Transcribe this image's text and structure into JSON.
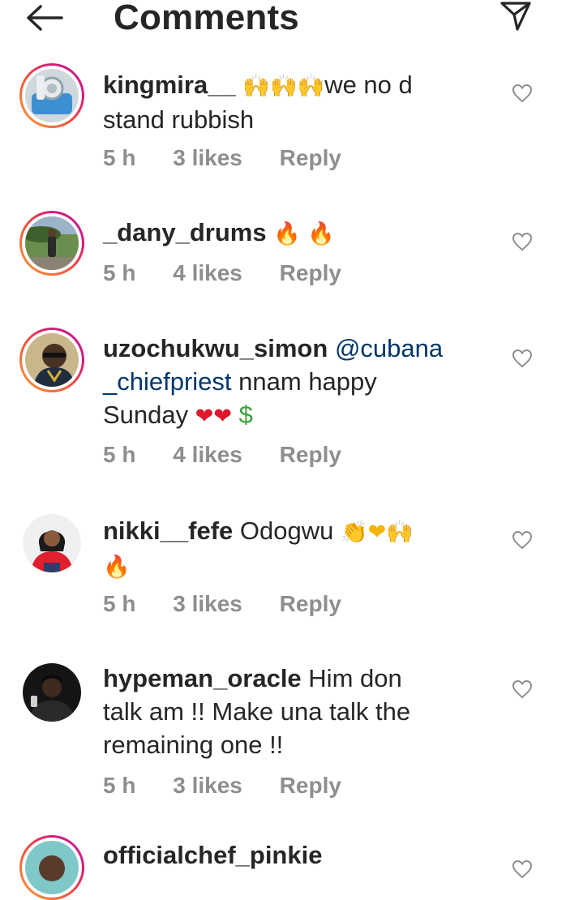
{
  "header": {
    "title": "Comments",
    "back_icon": "arrow-left-icon",
    "share_icon": "paper-plane-icon"
  },
  "colors": {
    "text": "#262626",
    "meta": "#8e8e8e",
    "mention": "#00376b",
    "story_ring_start": "#f9a13a",
    "story_ring_end": "#b32aa9"
  },
  "comments": [
    {
      "username": "kingmira__",
      "emoji_prefix": "🙌🙌🙌",
      "text_line1": "we no d",
      "text_line2": "stand rubbish",
      "time": "5 h",
      "likes": "3 likes",
      "reply": "Reply",
      "has_story_ring": true
    },
    {
      "username": "_dany_drums",
      "emoji_suffix": "🔥 🔥",
      "time": "5 h",
      "likes": "4 likes",
      "reply": "Reply",
      "has_story_ring": true
    },
    {
      "username": "uzochukwu_simon",
      "mention_line1": "@cubana",
      "mention_line2": "_chiefpriest",
      "text_after_mention": "nnam happy",
      "text_line3": "Sunday",
      "emoji_hearts": "❤❤",
      "emoji_dollar": "$",
      "time": "5 h",
      "likes": "4 likes",
      "reply": "Reply",
      "has_story_ring": true
    },
    {
      "username": "nikki__fefe",
      "text": "Odogwu",
      "emoji_line1": "👏❤🙌",
      "emoji_line2": "🔥",
      "time": "5 h",
      "likes": "3 likes",
      "reply": "Reply",
      "has_story_ring": false
    },
    {
      "username": "hypeman_oracle",
      "text_line1": "Him don",
      "text_line2": "talk am !! Make una talk the",
      "text_line3": "remaining one !!",
      "time": "5 h",
      "likes": "3 likes",
      "reply": "Reply",
      "has_story_ring": false
    },
    {
      "username": "officialchef_pinkie",
      "has_story_ring": true
    }
  ]
}
